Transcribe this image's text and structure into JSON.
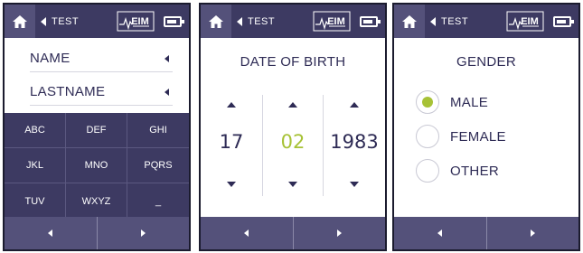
{
  "header": {
    "back_label": "TEST",
    "logo_text": "EIM"
  },
  "name_screen": {
    "fields": [
      {
        "label": "NAME"
      },
      {
        "label": "LASTNAME"
      }
    ],
    "keys": [
      "ABC",
      "DEF",
      "GHI",
      "JKL",
      "MNO",
      "PQRS",
      "TUV",
      "WXYZ",
      "_"
    ]
  },
  "dob_screen": {
    "title": "DATE OF BIRTH",
    "day": "17",
    "month": "02",
    "year": "1983"
  },
  "gender_screen": {
    "title": "GENDER",
    "options": [
      {
        "label": "MALE",
        "selected": true
      },
      {
        "label": "FEMALE",
        "selected": false
      },
      {
        "label": "OTHER",
        "selected": false
      }
    ]
  },
  "colors": {
    "header_bg": "#3d3a62",
    "home_bg": "#54517a",
    "accent": "#a7c236",
    "text": "#2e2b55"
  },
  "icons": [
    "home-icon",
    "back-icon",
    "battery-icon",
    "prev-icon",
    "next-icon",
    "radio-icon"
  ]
}
